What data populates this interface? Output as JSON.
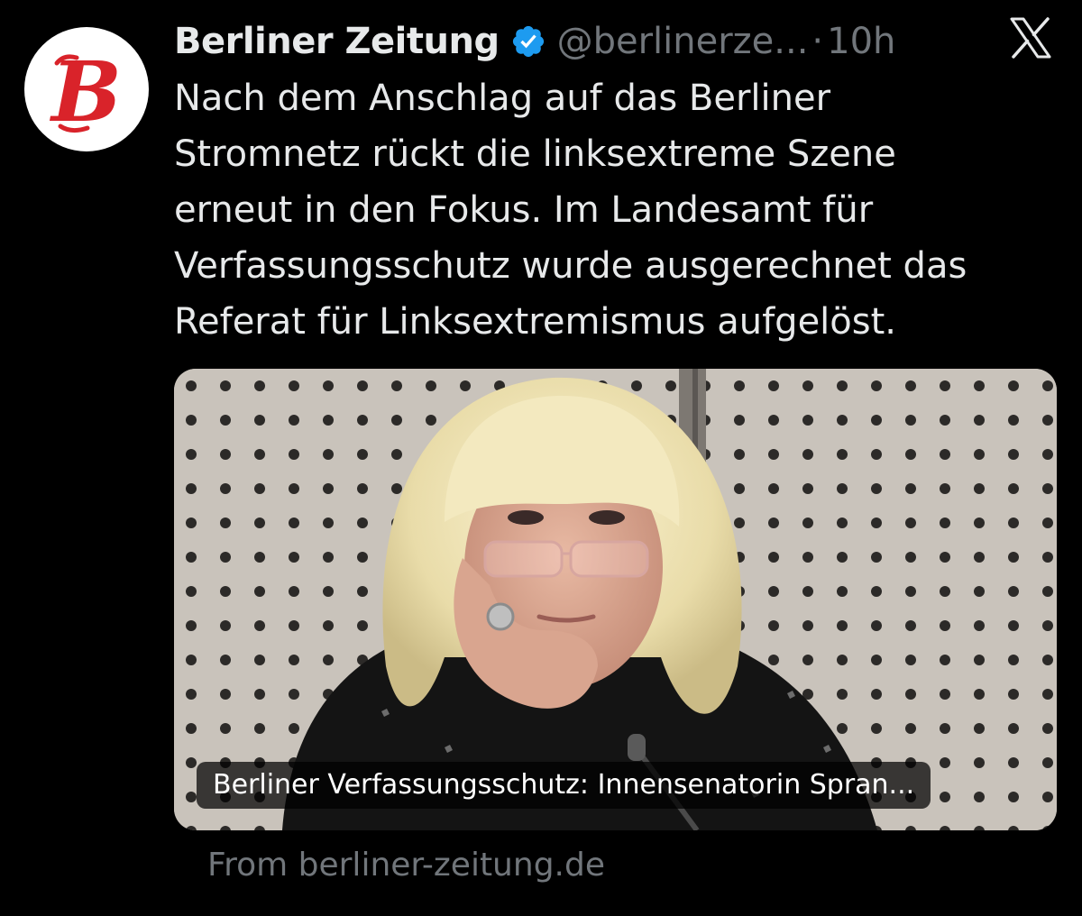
{
  "tweet": {
    "display_name": "Berliner Zeitung",
    "handle": "@berlinerze...",
    "separator": "·",
    "time": "10h",
    "avatar_letter": "B",
    "text_lines": [
      "Nach dem Anschlag auf das Berliner",
      "Stromnetz rückt die linksextreme Szene",
      "erneut in den Fokus. Im Landesamt für",
      "Verfassungsschutz wurde ausgerechnet das",
      "Referat für Linksextremismus aufgelöst."
    ]
  },
  "link_card": {
    "title": "Berliner Verfassungsschutz: Innensenatorin Spran...",
    "source": "From berliner-zeitung.de"
  },
  "icons": {
    "brand": "x-logo-icon",
    "verified": "verified-badge-icon"
  },
  "colors": {
    "background": "#000000",
    "text_primary": "#e7e9ea",
    "text_secondary": "#71767b",
    "verified_blue": "#1d9bf0",
    "avatar_red": "#d9232a"
  }
}
